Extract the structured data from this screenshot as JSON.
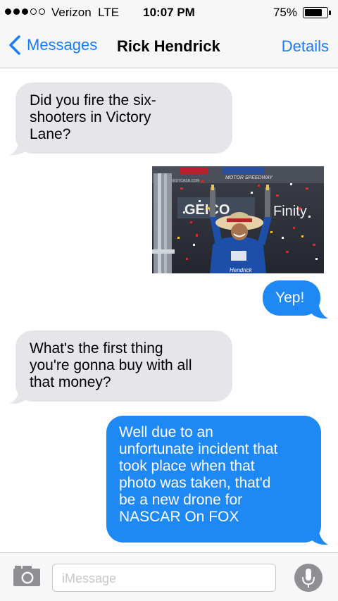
{
  "status_bar": {
    "carrier": "Verizon",
    "network": "LTE",
    "time": "10:07 PM",
    "battery": "75%"
  },
  "nav": {
    "back_label": "Messages",
    "title": "Rick Hendrick",
    "details_label": "Details"
  },
  "messages": [
    {
      "from": "them",
      "text": "Did you fire the six-\nshooters in Victory\nLane?"
    },
    {
      "from": "me",
      "image": "victory-lane-photo"
    },
    {
      "from": "me",
      "text": "Yep!"
    },
    {
      "from": "them",
      "text": "What's the first thing\nyou're gonna buy with all\nthat money?"
    },
    {
      "from": "me",
      "text": "Well due to an\nunfortunate incident that\ntook place when that\nphoto was taken, that'd\nbe a new drone for\nNASCAR On FOX"
    }
  ],
  "photo_text": {
    "sponsor": "GEICO",
    "brand": "Finity",
    "sign_top": "MOTOR SPEEDWAY",
    "sign_small": "SPEEDYCASH.COM"
  },
  "input": {
    "placeholder": "iMessage"
  },
  "colors": {
    "accent": "#1a7cf5",
    "bubble_out": "#1e88f5",
    "bubble_in": "#e5e5ea"
  }
}
